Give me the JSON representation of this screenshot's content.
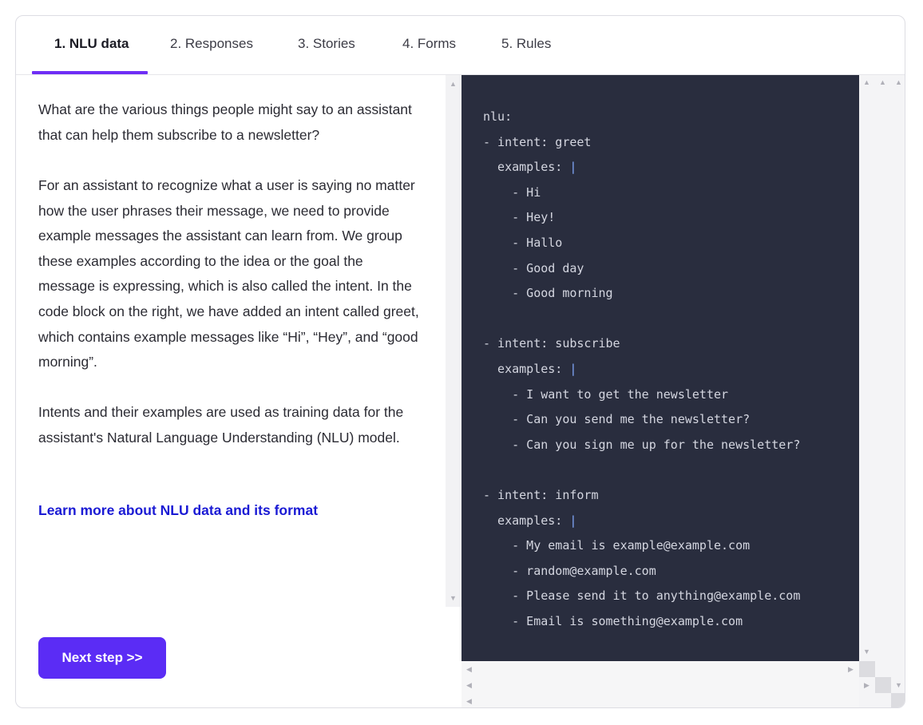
{
  "tabs": [
    {
      "label": "1. NLU data",
      "active": true
    },
    {
      "label": "2. Responses",
      "active": false
    },
    {
      "label": "3. Stories",
      "active": false
    },
    {
      "label": "4. Forms",
      "active": false
    },
    {
      "label": "5. Rules",
      "active": false
    }
  ],
  "content": {
    "paragraph_1": "What are the various things people might say to an assistant that can help them subscribe to a newsletter?",
    "paragraph_2": "For an assistant to recognize what a user is saying no matter how the user phrases their message, we need to provide example messages the assistant can learn from. We group these examples according to the idea or the goal the message is expressing, which is also called the intent. In the code block on the right, we have added an intent called greet, which contains example messages like “Hi”, “Hey”, and “good morning”.",
    "paragraph_3": "Intents and their examples are used as training data for the assistant's Natural Language Understanding (NLU) model.",
    "learn_more_link": "Learn more about NLU data and its format",
    "next_button": "Next step >>"
  },
  "code": {
    "root": "nlu:",
    "intents": [
      {
        "intent_line": "- intent: greet",
        "examples_line": "  examples: ",
        "examples": [
          "Hi",
          "Hey!",
          "Hallo",
          "Good day",
          "Good morning"
        ]
      },
      {
        "intent_line": "- intent: subscribe",
        "examples_line": "  examples: ",
        "examples": [
          "I want to get the newsletter",
          "Can you send me the newsletter?",
          "Can you sign me up for the newsletter?"
        ]
      },
      {
        "intent_line": "- intent: inform",
        "examples_line": "  examples: ",
        "examples": [
          "My email is example@example.com",
          "random@example.com",
          "Please send it to anything@example.com",
          "Email is something@example.com"
        ]
      }
    ],
    "pipe": "|"
  },
  "colors": {
    "accent": "#6f2ef5",
    "button": "#5b2cf5",
    "link": "#1a1ad4",
    "code_bg": "#292d3e"
  }
}
